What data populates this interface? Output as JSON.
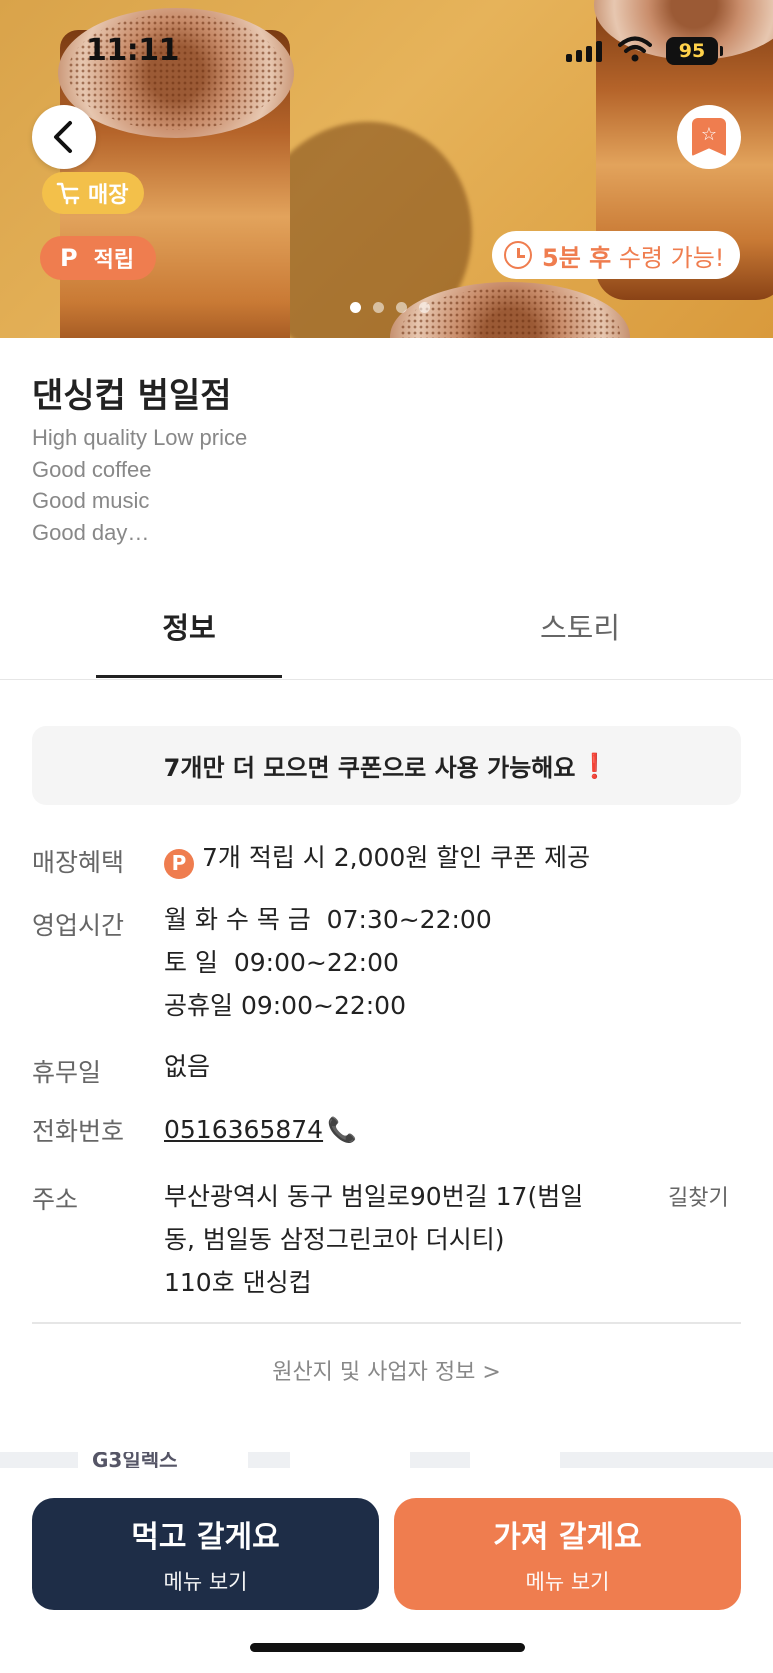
{
  "status_bar": {
    "time": "11:11",
    "battery": "95"
  },
  "hero": {
    "badges": {
      "store": "매장",
      "point_symbol": "P",
      "point": "적립"
    },
    "pickup": {
      "bold": "5분 후",
      "rest": " 수령 가능!"
    },
    "carousel": {
      "count": 4,
      "active": 0
    }
  },
  "store": {
    "name": "댄싱컵 범일점",
    "description": [
      "High quality Low price",
      "Good coffee",
      "Good music",
      "Good day…"
    ]
  },
  "tabs": [
    {
      "label": "정보",
      "active": true
    },
    {
      "label": "스토리",
      "active": false
    }
  ],
  "notice": {
    "text": "7개만 더 모으면 쿠폰으로 사용 가능해요",
    "mark": "❗"
  },
  "details": {
    "benefit": {
      "label": "매장혜택",
      "icon": "P",
      "value": "7개 적립 시 2,000원 할인 쿠폰 제공"
    },
    "hours": {
      "label": "영업시간",
      "lines": [
        "월 화 수 목 금  07:30~22:00",
        "토 일  09:00~22:00",
        "공휴일 09:00~22:00"
      ]
    },
    "closed": {
      "label": "휴무일",
      "value": "없음"
    },
    "phone": {
      "label": "전화번호",
      "value": "0516365874"
    },
    "address": {
      "label": "주소",
      "lines": [
        "부산광역시 동구 범일로90번길 17(범일",
        "동, 범일동 삼정그린코아 더시티)",
        "110호 댄싱컵"
      ],
      "directions": "길찾기"
    }
  },
  "origin_link": "원산지 및 사업자 정보 >",
  "map": {
    "text": "G3일렉스"
  },
  "bottom": {
    "eat_in": {
      "label": "먹고 갈게요",
      "sub": "메뉴 보기"
    },
    "take_out": {
      "label": "가져 갈게요",
      "sub": "메뉴 보기"
    }
  },
  "colors": {
    "accent": "#ef7d4f",
    "navy": "#1e2d47",
    "store_badge": "#f3c04a"
  }
}
